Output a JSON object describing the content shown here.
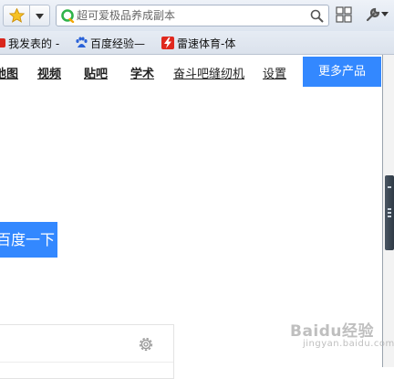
{
  "toolbar": {
    "search_placeholder": "超可爱极品养成副本"
  },
  "bookmarks": [
    {
      "label": "我发表的 -",
      "icon": "red-favicon"
    },
    {
      "label": "百度经验—",
      "icon": "baidu-paw-icon"
    },
    {
      "label": "雷速体育-体",
      "icon": "red-lightning-icon"
    }
  ],
  "nav": {
    "items": [
      "地图",
      "视频",
      "贴吧",
      "学术",
      "奋斗吧缝纫机",
      "设置"
    ],
    "more_label": "更多产品"
  },
  "search_button": {
    "label": "百度一下"
  },
  "watermark": {
    "logo": "Baidu经验",
    "sub": "jingyan.baidu.com"
  },
  "colors": {
    "accent": "#3388ff"
  }
}
